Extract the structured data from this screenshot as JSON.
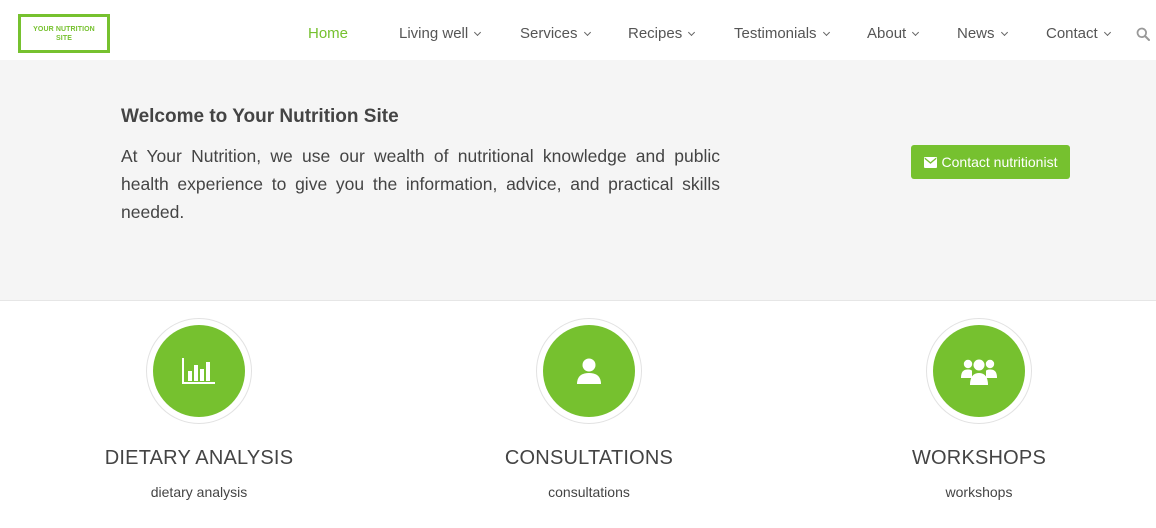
{
  "logo": {
    "line1": "YOUR NUTRITION",
    "line2": "SITE"
  },
  "nav": [
    {
      "label": "Home",
      "has_dropdown": false,
      "active": true
    },
    {
      "label": "Living well",
      "has_dropdown": true
    },
    {
      "label": "Services",
      "has_dropdown": true
    },
    {
      "label": "Recipes",
      "has_dropdown": true
    },
    {
      "label": "Testimonials",
      "has_dropdown": true
    },
    {
      "label": "About",
      "has_dropdown": true
    },
    {
      "label": "News",
      "has_dropdown": true
    },
    {
      "label": "Contact",
      "has_dropdown": true
    }
  ],
  "search_icon": "search-icon",
  "hero": {
    "title": "Welcome to Your Nutrition Site",
    "text": "At Your Nutrition, we use our wealth of nutritional knowledge and public health experience to give you the information, advice, and practical skills needed.",
    "cta_label": "Contact nutritionist",
    "cta_icon": "envelope-icon"
  },
  "services": [
    {
      "icon": "bar-chart-icon",
      "title": "DIETARY ANALYSIS",
      "subtitle": "dietary analysis"
    },
    {
      "icon": "user-icon",
      "title": "CONSULTATIONS",
      "subtitle": "consultations"
    },
    {
      "icon": "users-icon",
      "title": "WORKSHOPS",
      "subtitle": "workshops"
    }
  ],
  "colors": {
    "accent": "#76c12f",
    "text": "#444444",
    "hero_bg": "#f5f5f5"
  }
}
